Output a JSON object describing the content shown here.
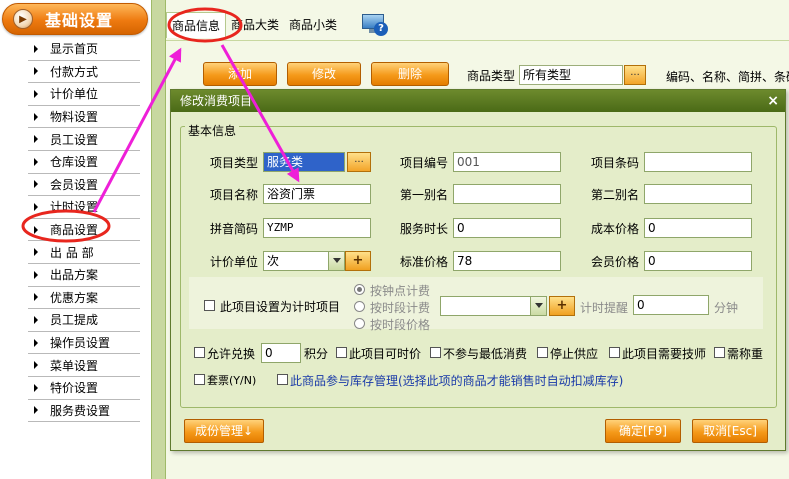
{
  "sidebar": {
    "title": "基础设置",
    "items": [
      "显示首页",
      "付款方式",
      "计价单位",
      "物料设置",
      "员工设置",
      "仓库设置",
      "会员设置",
      "计时设置",
      "商品设置",
      "出 品 部",
      "出品方案",
      "优惠方案",
      "员工提成",
      "操作员设置",
      "菜单设置",
      "特价设置",
      "服务费设置"
    ]
  },
  "tabs": [
    "商品信息",
    "商品大类",
    "商品小类"
  ],
  "toolbar": {
    "add": "添加",
    "edit": "修改",
    "delete": "删除",
    "type_label": "商品类型",
    "type_value": "所有类型",
    "dots": "...",
    "search_hint": "编码、名称、简拼、条码"
  },
  "dialog": {
    "title": "修改消费项目",
    "close": "×",
    "legend": "基本信息",
    "fields": {
      "item_type_label": "项目类型",
      "item_type_value": "服务类",
      "item_no_label": "项目编号",
      "item_no_value": "001",
      "barcode_label": "项目条码",
      "barcode_value": "",
      "name_label": "项目名称",
      "name_value": "浴资门票",
      "alias1_label": "第一别名",
      "alias1_value": "",
      "alias2_label": "第二别名",
      "alias2_value": "",
      "pinyin_label": "拼音简码",
      "pinyin_value": "YZMP",
      "duration_label": "服务时长",
      "duration_value": "0",
      "cost_label": "成本价格",
      "cost_value": "0",
      "unit_label": "计价单位",
      "unit_value": "次",
      "price_label": "标准价格",
      "price_value": "78",
      "member_label": "会员价格",
      "member_value": "0"
    },
    "timed": {
      "checkbox": "此项目设置为计时项目",
      "radio1": "按钟点计费",
      "radio2": "按时段计费",
      "radio3": "按时段价格",
      "remind_label": "计时提醒",
      "remind_value": "0",
      "unit": "分钟"
    },
    "options": {
      "exchange": "允许兑换",
      "points_value": "0",
      "points_unit": "积分",
      "time_price": "此项目可时价",
      "no_min": "不参与最低消费",
      "stop": "停止供应",
      "tech": "此项目需要技师",
      "weigh": "需称重",
      "package": "套票(Y/N)",
      "stock": "此商品参与库存管理(选择此项的商品才能销售时自动扣减库存)"
    },
    "buttons": {
      "cost": "成份管理↓",
      "ok": "确定[F9]",
      "cancel": "取消[Esc]"
    }
  },
  "colors": {
    "annotation": "#ee1fd8",
    "circle": "#e8261e",
    "accent": "#f59a1a",
    "title_bar": "#4f6f1c"
  }
}
